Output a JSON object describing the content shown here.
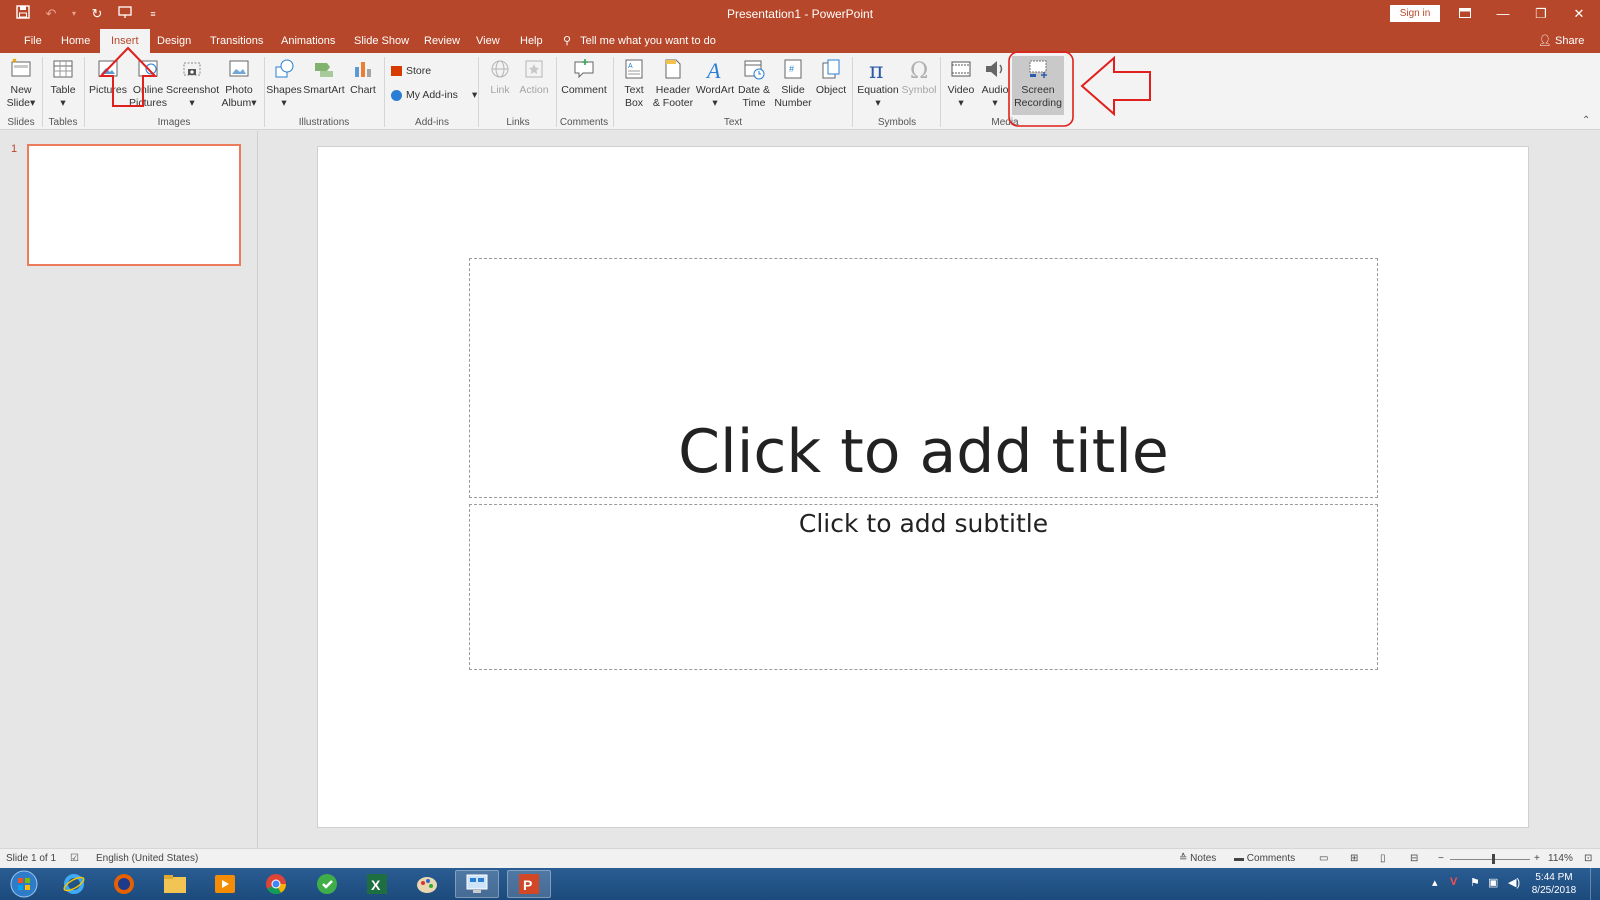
{
  "window": {
    "title": "Presentation1  -  PowerPoint",
    "sign_in": "Sign in",
    "share": "Share"
  },
  "tabs": [
    {
      "label": "File"
    },
    {
      "label": "Home"
    },
    {
      "label": "Insert",
      "active": true
    },
    {
      "label": "Design"
    },
    {
      "label": "Transitions"
    },
    {
      "label": "Animations"
    },
    {
      "label": "Slide Show"
    },
    {
      "label": "Review"
    },
    {
      "label": "View"
    },
    {
      "label": "Help"
    }
  ],
  "tell_me": "Tell me what you want to do",
  "ribbon": {
    "slides": {
      "new_slide_1": "New",
      "new_slide_2": "Slide",
      "group": "Slides"
    },
    "tables": {
      "table": "Table",
      "group": "Tables"
    },
    "images": {
      "pictures": "Pictures",
      "online_1": "Online",
      "online_2": "Pictures",
      "screenshot": "Screenshot",
      "photo_1": "Photo",
      "photo_2": "Album",
      "group": "Images"
    },
    "illustrations": {
      "shapes": "Shapes",
      "smartart": "SmartArt",
      "chart": "Chart",
      "group": "Illustrations"
    },
    "addins": {
      "store": "Store",
      "my_addins": "My Add-ins",
      "group": "Add-ins"
    },
    "links": {
      "link": "Link",
      "action": "Action",
      "group": "Links"
    },
    "comments": {
      "comment": "Comment",
      "group": "Comments"
    },
    "text": {
      "textbox_1": "Text",
      "textbox_2": "Box",
      "header_1": "Header",
      "header_2": "& Footer",
      "wordart": "WordArt",
      "date_1": "Date &",
      "date_2": "Time",
      "slidenum_1": "Slide",
      "slidenum_2": "Number",
      "object": "Object",
      "group": "Text"
    },
    "symbols": {
      "equation": "Equation",
      "symbol": "Symbol",
      "group": "Symbols"
    },
    "media": {
      "video": "Video",
      "audio": "Audio",
      "screen_1": "Screen",
      "screen_2": "Recording",
      "group": "Media"
    }
  },
  "slides_pane": {
    "slide_number": "1"
  },
  "slide": {
    "title_placeholder": "Click to add title",
    "subtitle_placeholder": "Click to add subtitle"
  },
  "status": {
    "slide_of": "Slide 1 of 1",
    "language": "English (United States)",
    "notes": "Notes",
    "comments": "Comments",
    "zoom": "114%"
  },
  "taskbar": {
    "time": "5:44 PM",
    "date": "8/25/2018"
  },
  "colors": {
    "accent": "#b7472a",
    "annotation": "#e0201c"
  }
}
